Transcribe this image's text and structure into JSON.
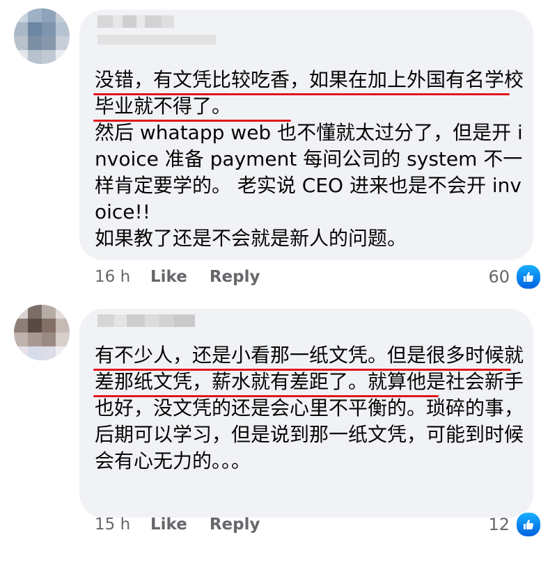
{
  "comments": [
    {
      "text": "没错，有文凭比较吃香，如果在加上外国有名学校毕业就不得了。\n然后 whatapp web 也不懂就太过分了，但是开 invoice 准备 payment 每间公司的 system 不一样肯定要学的。 老实说 CEO 进来也是不会开 invoice!!\n如果教了还是不会就是新人的问题。",
      "time": "16 h",
      "like_label": "Like",
      "reply_label": "Reply",
      "reaction_count": "60"
    },
    {
      "text": "有不少人，还是小看那一纸文凭。但是很多时候就差那纸文凭，薪水就有差距了。就算他是社会新手也好，没文凭的还是会心里不平衡的。琐碎的事，后期可以学习，但是说到那一纸文凭，可能到时候会有心无力的。。。",
      "time": "15 h",
      "like_label": "Like",
      "reply_label": "Reply",
      "reaction_count": "12"
    }
  ],
  "colors": {
    "bubble": "#f0f2f5",
    "underline": "#e0161b",
    "meta_text": "#65676b",
    "like_blue": "#1877f2"
  },
  "icons": {
    "reaction": "thumbs-up-icon"
  }
}
